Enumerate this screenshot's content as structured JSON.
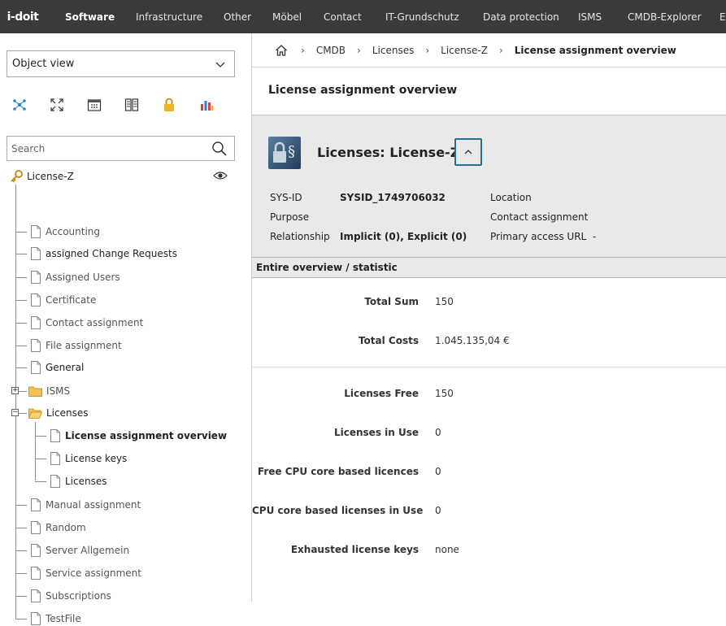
{
  "topnav": {
    "logo": "i-doit",
    "items": [
      "Software",
      "Infrastructure",
      "Other",
      "Möbel",
      "Contact",
      "IT-Grundschutz",
      "Data protection",
      "ISMS",
      "CMDB-Explorer",
      "E"
    ]
  },
  "sidebar": {
    "view_select": "Object view",
    "toolbar_icons": [
      "relation-icon",
      "fullscreen-icon",
      "calendar-icon",
      "catalog-icon",
      "lock-icon",
      "chart-icon"
    ],
    "search_placeholder": "Search",
    "tree": {
      "root": "License-Z",
      "items": [
        "Accounting",
        "assigned Change Requests",
        "Assigned Users",
        "Certificate",
        "Contact assignment",
        "File assignment",
        "General",
        "ISMS",
        "Licenses",
        "License assignment overview",
        "License keys",
        "Licenses",
        "Manual assignment",
        "Random",
        "Server Allgemein",
        "Service assignment",
        "Subscriptions",
        "TestFile"
      ]
    }
  },
  "breadcrumb": [
    "CMDB",
    "Licenses",
    "License-Z",
    "License assignment overview"
  ],
  "page_title": "License assignment overview",
  "object": {
    "title": "Licenses: License-Z",
    "sysid_label": "SYS-ID",
    "sysid_value": "SYSID_1749706032",
    "purpose_label": "Purpose",
    "relationship_label": "Relationship",
    "relationship_value": "Implicit (0), Explicit (0)",
    "location_label": "Location",
    "contact_label": "Contact assignment",
    "url_label": "Primary access URL",
    "url_value": "-"
  },
  "section_title": "Entire overview / statistic",
  "stats": {
    "total_sum_label": "Total Sum",
    "total_sum": "150",
    "total_costs_label": "Total Costs",
    "total_costs": "1.045.135,04 €",
    "free_label": "Licenses Free",
    "free": "150",
    "in_use_label": "Licenses in Use",
    "in_use": "0",
    "free_cpu_label": "Free CPU core based licences",
    "free_cpu": "0",
    "cpu_in_use_label": "CPU core based licenses in Use",
    "cpu_in_use": "0",
    "exhausted_label": "Exhausted license keys",
    "exhausted": "none"
  },
  "colors": {
    "topbar": "#3a3a3a",
    "panel": "#e9e9e9",
    "accent": "#2a6f8f",
    "folder": "#f2c14e"
  }
}
